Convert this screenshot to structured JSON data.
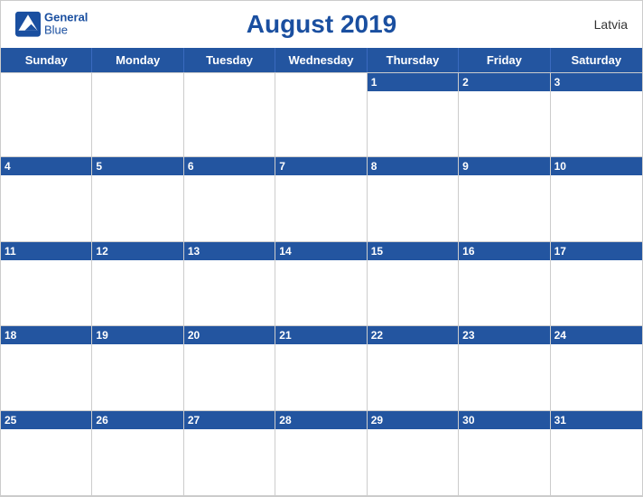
{
  "header": {
    "title": "August 2019",
    "country": "Latvia",
    "logo": {
      "line1": "General",
      "line2": "Blue"
    }
  },
  "days": {
    "headers": [
      "Sunday",
      "Monday",
      "Tuesday",
      "Wednesday",
      "Thursday",
      "Friday",
      "Saturday"
    ]
  },
  "weeks": [
    [
      {
        "date": "",
        "empty": true
      },
      {
        "date": "",
        "empty": true
      },
      {
        "date": "",
        "empty": true
      },
      {
        "date": "",
        "empty": true
      },
      {
        "date": "1",
        "empty": false
      },
      {
        "date": "2",
        "empty": false
      },
      {
        "date": "3",
        "empty": false
      }
    ],
    [
      {
        "date": "4",
        "empty": false
      },
      {
        "date": "5",
        "empty": false
      },
      {
        "date": "6",
        "empty": false
      },
      {
        "date": "7",
        "empty": false
      },
      {
        "date": "8",
        "empty": false
      },
      {
        "date": "9",
        "empty": false
      },
      {
        "date": "10",
        "empty": false
      }
    ],
    [
      {
        "date": "11",
        "empty": false
      },
      {
        "date": "12",
        "empty": false
      },
      {
        "date": "13",
        "empty": false
      },
      {
        "date": "14",
        "empty": false
      },
      {
        "date": "15",
        "empty": false
      },
      {
        "date": "16",
        "empty": false
      },
      {
        "date": "17",
        "empty": false
      }
    ],
    [
      {
        "date": "18",
        "empty": false
      },
      {
        "date": "19",
        "empty": false
      },
      {
        "date": "20",
        "empty": false
      },
      {
        "date": "21",
        "empty": false
      },
      {
        "date": "22",
        "empty": false
      },
      {
        "date": "23",
        "empty": false
      },
      {
        "date": "24",
        "empty": false
      }
    ],
    [
      {
        "date": "25",
        "empty": false
      },
      {
        "date": "26",
        "empty": false
      },
      {
        "date": "27",
        "empty": false
      },
      {
        "date": "28",
        "empty": false
      },
      {
        "date": "29",
        "empty": false
      },
      {
        "date": "30",
        "empty": false
      },
      {
        "date": "31",
        "empty": false
      }
    ]
  ],
  "colors": {
    "header_bg": "#2355a0",
    "header_text": "#ffffff",
    "title_color": "#1a4fa0",
    "border_color": "#cccccc"
  }
}
